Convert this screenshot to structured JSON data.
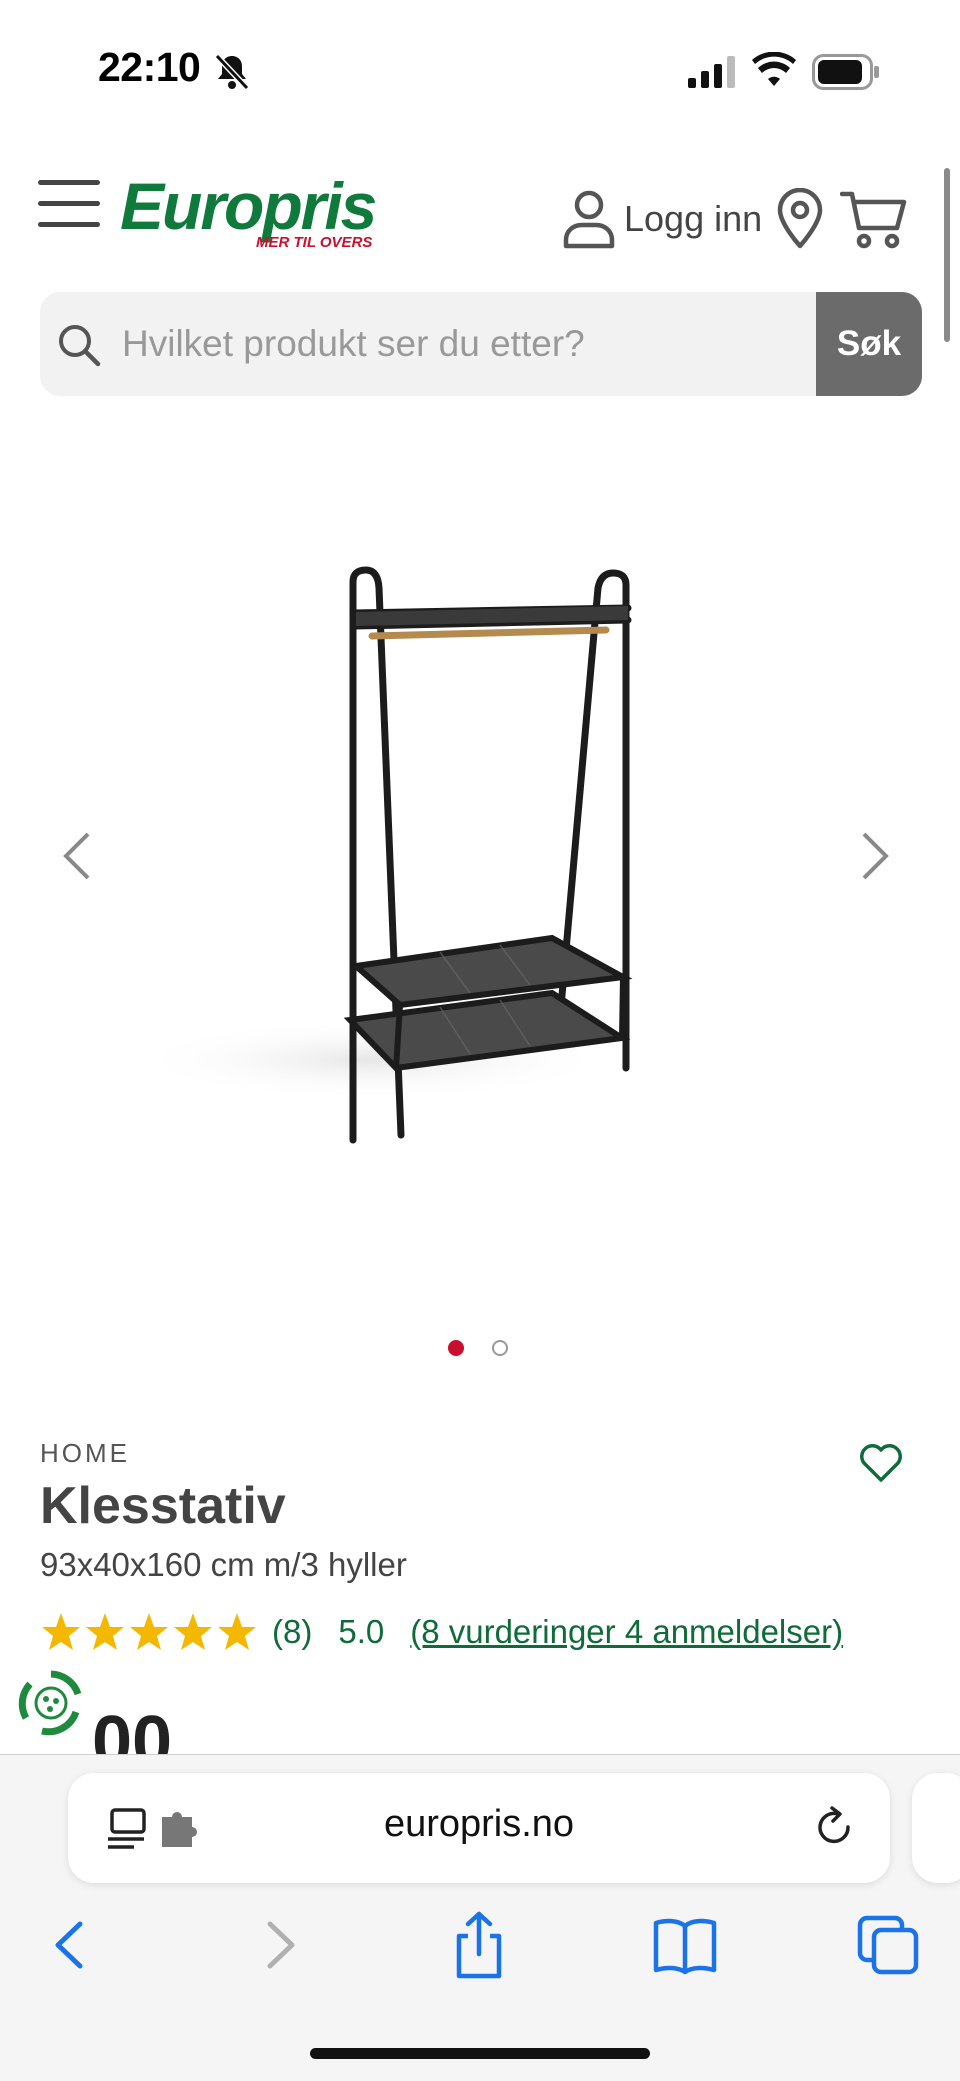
{
  "status_bar": {
    "time": "22:10",
    "icons": [
      "bell-slash-icon",
      "cellular-signal-icon",
      "wifi-icon",
      "battery-icon"
    ]
  },
  "header": {
    "logo_text": "Europris",
    "logo_tagline": "MER TIL OVERS",
    "login_label": "Logg inn",
    "brand_colors": {
      "green": "#0f7a3c",
      "red": "#c8102e"
    }
  },
  "search": {
    "placeholder": "Hvilket produkt ser du etter?",
    "button_label": "Søk"
  },
  "gallery": {
    "image_count": 2,
    "active_index": 0
  },
  "product": {
    "brand": "HOME",
    "title": "Klesstativ",
    "subtitle": "93x40x160 cm m/3 hyller",
    "stars": 5,
    "rating_count_label": "(8)",
    "rating_score": "5.0",
    "reviews_link": "(8 vurderinger 4 anmeldelser)",
    "price_partial": "00"
  },
  "browser": {
    "url": "europris.no",
    "nav_icons": [
      "back-icon",
      "forward-icon",
      "share-icon",
      "bookmarks-icon",
      "tabs-icon"
    ]
  }
}
